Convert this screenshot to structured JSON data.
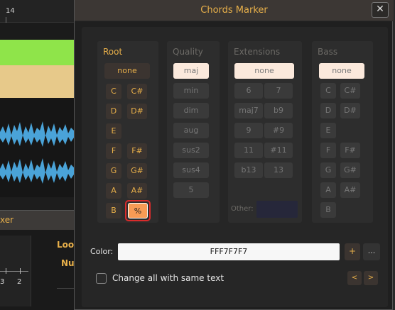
{
  "background": {
    "ruler_number": "14",
    "chord_symbol": "⁒",
    "marker_text": "xer",
    "lower_heading_1": "Loo",
    "lower_heading_2": "Nu",
    "slider_value_left": "3",
    "slider_value_right": "2"
  },
  "dialog": {
    "title": "Chords Marker",
    "close_glyph": "✕"
  },
  "root": {
    "title": "Root",
    "none": "none",
    "notes": [
      "C",
      "C#",
      "D",
      "D#",
      "E",
      "F",
      "F#",
      "G",
      "G#",
      "A",
      "A#",
      "B",
      "%"
    ],
    "selected": "%"
  },
  "quality": {
    "title": "Quality",
    "options": [
      "maj",
      "min",
      "dim",
      "aug",
      "sus2",
      "sus4",
      "5"
    ],
    "selected": "maj"
  },
  "extensions": {
    "title": "Extensions",
    "none": "none",
    "options": [
      "6",
      "7",
      "maj7",
      "b9",
      "9",
      "#9",
      "11",
      "#11",
      "b13",
      "13"
    ],
    "other_label": "Other:",
    "other_value": ""
  },
  "bass": {
    "title": "Bass",
    "none": "none",
    "notes": [
      "C",
      "C#",
      "D",
      "D#",
      "E",
      "F",
      "F#",
      "G",
      "G#",
      "A",
      "A#",
      "B"
    ]
  },
  "color": {
    "label": "Color:",
    "value": "FFF7F7F7",
    "add_label": "+",
    "more_label": "..."
  },
  "footer": {
    "checkbox_label": "Change all with same text",
    "checkbox_checked": false,
    "prev_label": "<",
    "next_label": ">"
  },
  "colors": {
    "accent": "#e8b04a",
    "highlight": "#f79b55",
    "selected_bg": "#fbe9dc",
    "annotation_ring": "#d92b2b",
    "timeline_green": "#8fe44a",
    "waveform": "#4aa3d8"
  }
}
